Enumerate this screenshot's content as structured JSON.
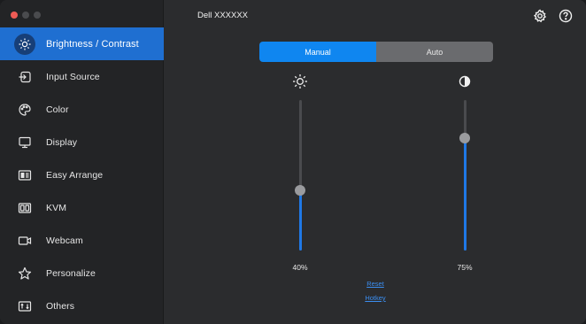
{
  "window": {
    "traffic_lights": [
      "close",
      "minimize",
      "zoom"
    ]
  },
  "sidebar": {
    "items": [
      {
        "label": "Brightness / Contrast",
        "icon": "brightness-icon",
        "active": true
      },
      {
        "label": "Input Source",
        "icon": "input-source-icon",
        "active": false
      },
      {
        "label": "Color",
        "icon": "color-icon",
        "active": false
      },
      {
        "label": "Display",
        "icon": "display-icon",
        "active": false
      },
      {
        "label": "Easy Arrange",
        "icon": "easy-arrange-icon",
        "active": false
      },
      {
        "label": "KVM",
        "icon": "kvm-icon",
        "active": false
      },
      {
        "label": "Webcam",
        "icon": "webcam-icon",
        "active": false
      },
      {
        "label": "Personalize",
        "icon": "star-icon",
        "active": false
      },
      {
        "label": "Others",
        "icon": "others-icon",
        "active": false
      }
    ]
  },
  "header": {
    "title": "Dell XXXXXX",
    "icons": [
      "gear-icon",
      "help-icon"
    ]
  },
  "mode": {
    "options": [
      "Manual",
      "Auto"
    ],
    "selected": "Manual"
  },
  "sliders": {
    "brightness": {
      "value": 40,
      "label": "40%",
      "icon": "sun-icon"
    },
    "contrast": {
      "value": 75,
      "label": "75%",
      "icon": "contrast-icon"
    }
  },
  "links": {
    "reset": "Reset",
    "hotkey": "Hotkey"
  },
  "colors": {
    "accent": "#1f6fd1",
    "segment_on": "#0f86f0",
    "slider_fill": "#1f78e6",
    "link": "#3b8ef0"
  }
}
